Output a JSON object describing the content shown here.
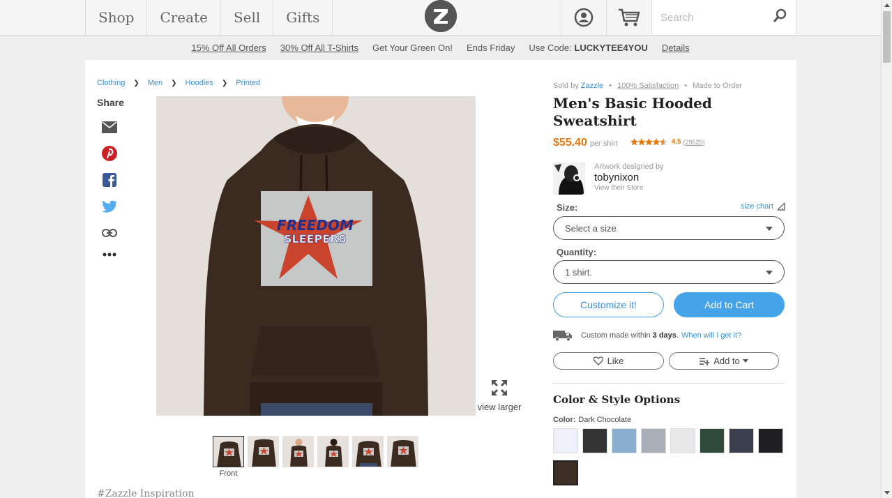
{
  "nav": {
    "items": [
      "Shop",
      "Create",
      "Sell",
      "Gifts"
    ],
    "search_placeholder": "Search"
  },
  "promo": {
    "items": [
      "15% Off All Orders",
      "30% Off All T-Shirts",
      "Get Your Green On!",
      "Ends Friday"
    ],
    "code_prefix": "Use Code:",
    "code": "LUCKYTEE4YOU",
    "details": "Details"
  },
  "breadcrumb": [
    "Clothing",
    "Men",
    "Hoodies",
    "Printed"
  ],
  "share": {
    "title": "Share",
    "icons": [
      "email-icon",
      "pinterest-icon",
      "facebook-icon",
      "twitter-icon",
      "link-icon",
      "more-icon"
    ]
  },
  "product_image": {
    "text_line1": "FREEDOM",
    "text_line2": "SLEEPERS"
  },
  "view_larger": "view larger",
  "thumbnails": {
    "count": 6,
    "selected_label": "Front"
  },
  "inspiration": "#Zazzle Inspiration",
  "product": {
    "sold_by_prefix": "Sold by",
    "seller": "Zazzle",
    "satisfaction": "100% Satisfaction",
    "made_to_order": "Made to Order",
    "title": "Men's Basic Hooded Sweatshirt",
    "price": "$55.40",
    "per_unit": "per shirt",
    "rating": "4.5",
    "rating_value": 4.5,
    "review_count": "(29525)"
  },
  "designer": {
    "caption": "Artwork designed by",
    "name": "tobynixon",
    "store_link": "View their Store"
  },
  "size": {
    "label": "Size:",
    "chart_link": "size chart",
    "value": "Select a size"
  },
  "quantity": {
    "label": "Quantity:",
    "value": "1 shirt."
  },
  "buttons": {
    "customize": "Customize it!",
    "add_to_cart": "Add to Cart",
    "like": "Like",
    "add_to": "Add to"
  },
  "shipping": {
    "text": "Custom made within",
    "days": "3 days",
    "link": "When will I get it?"
  },
  "options": {
    "title": "Color & Style Options",
    "color_label": "Color:",
    "color_value": "Dark Chocolate",
    "swatches": [
      "#eef0fb",
      "#333333",
      "#8aaed0",
      "#aaaeb9",
      "#e8e8e8",
      "#2f4a3b",
      "#3b3e4c",
      "#1e1e20",
      "#3d2e26"
    ],
    "selected_index": 8
  },
  "colors": {
    "accent": "#3c8fd2",
    "price": "#e57a0c",
    "hoodie": "#3b2a20"
  }
}
